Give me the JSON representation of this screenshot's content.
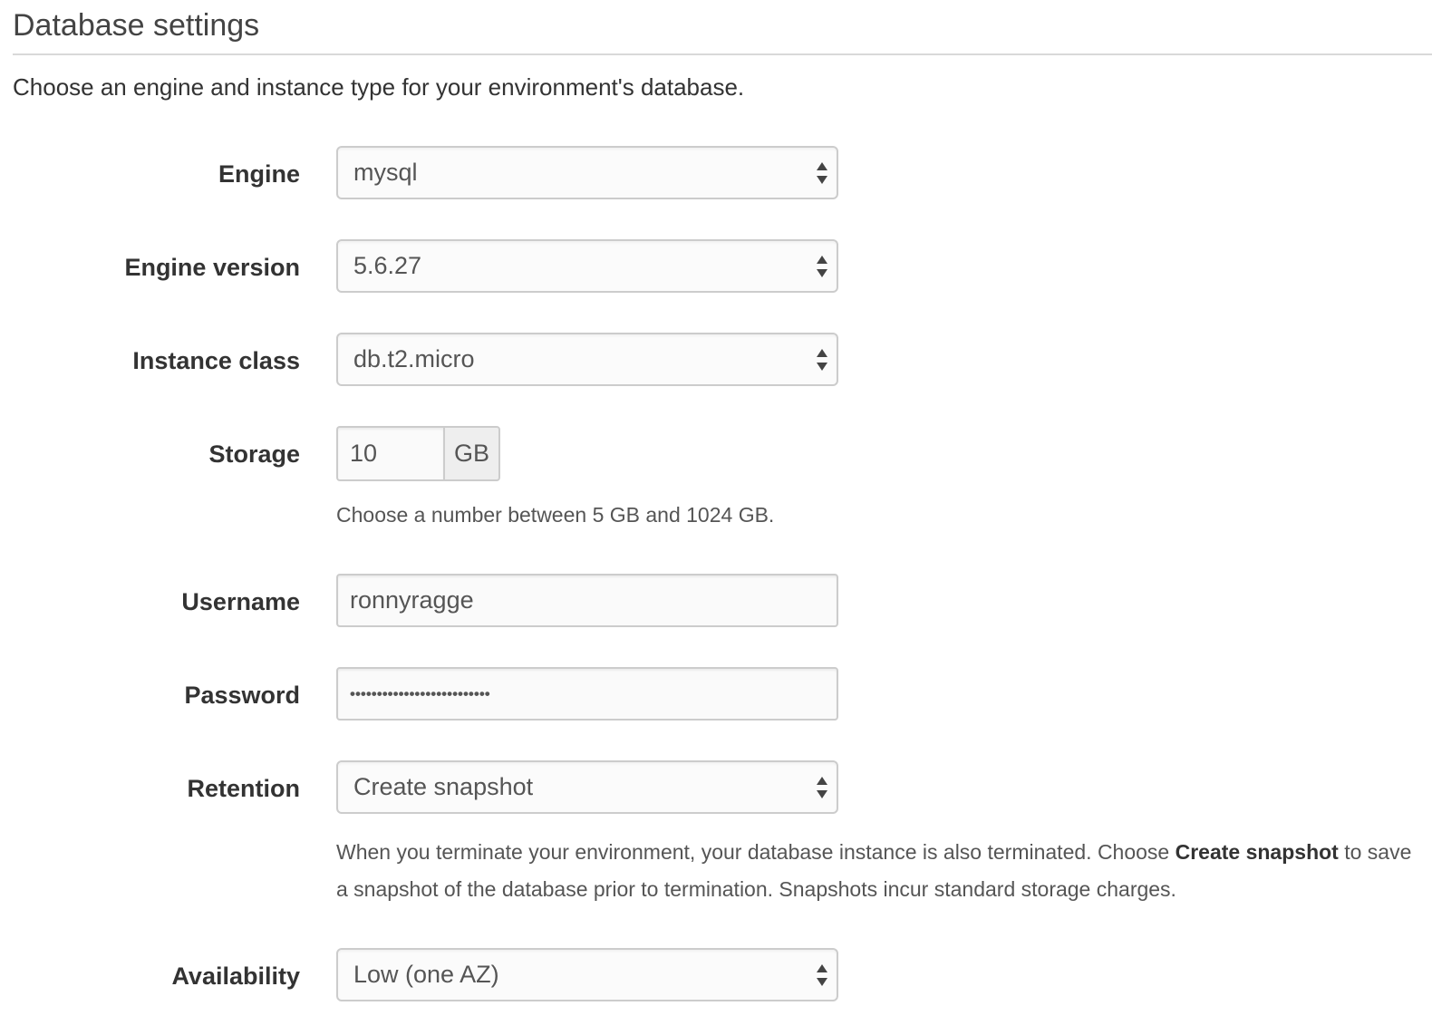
{
  "section": {
    "title": "Database settings",
    "intro": "Choose an engine and instance type for your environment's database."
  },
  "fields": {
    "engine": {
      "label": "Engine",
      "value": "mysql"
    },
    "engine_version": {
      "label": "Engine version",
      "value": "5.6.27"
    },
    "instance_class": {
      "label": "Instance class",
      "value": "db.t2.micro"
    },
    "storage": {
      "label": "Storage",
      "value": "10",
      "unit": "GB",
      "help": "Choose a number between 5 GB and 1024 GB."
    },
    "username": {
      "label": "Username",
      "value": "ronnyragge"
    },
    "password": {
      "label": "Password",
      "masked_value": "••••••••••••••••••••••••••"
    },
    "retention": {
      "label": "Retention",
      "value": "Create snapshot",
      "help_part1": "When you terminate your environment, your database instance is also terminated. Choose ",
      "help_bold": "Create snapshot",
      "help_part2": " to save a snapshot of the database prior to termination. Snapshots incur standard storage charges."
    },
    "availability": {
      "label": "Availability",
      "value": "Low (one AZ)"
    }
  },
  "icons": {
    "select_arrow": "up-down-arrows-icon"
  },
  "colors": {
    "border": "#cccccc",
    "label": "#333333",
    "value": "#555555",
    "addon_bg": "#eeeeee"
  }
}
